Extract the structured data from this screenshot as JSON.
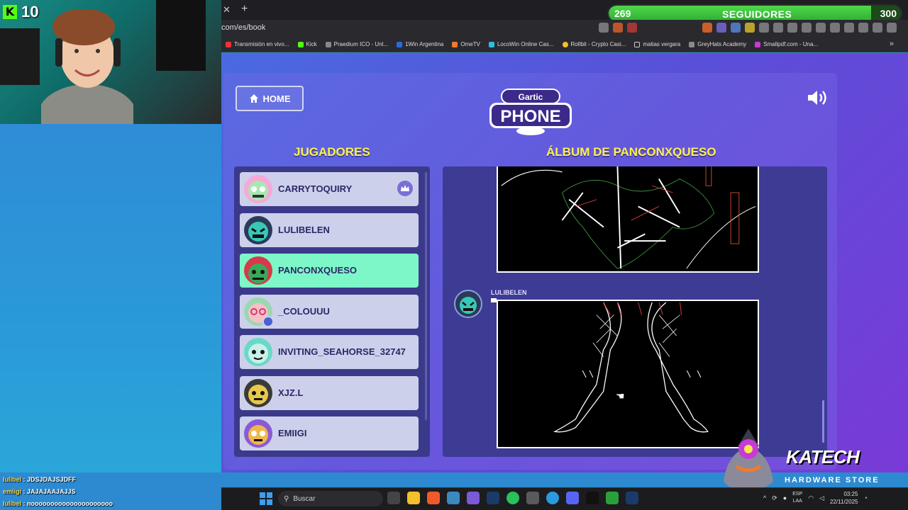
{
  "stream": {
    "kick_viewers": "10",
    "followers": {
      "current": "269",
      "label": "SEGUIDORES",
      "goal": "300",
      "progress": 0.897
    }
  },
  "browser": {
    "url": "com/es/book",
    "bookmarks": [
      "Transmisión en vivo...",
      "Kick",
      "Praedium ICO - Unl...",
      "1Win Argentina",
      "OmeTV",
      "LocoWin Online Cas...",
      "Rollbit - Crypto Casi...",
      "matias vergara",
      "GreyHats Academy",
      "Smallpdf.com - Una..."
    ]
  },
  "game": {
    "home_label": "HOME",
    "logo_line1": "Gartic",
    "logo_line2": "PHONE",
    "players_heading": "JUGADORES",
    "album_heading": "ÁLBUM DE PANCONXQUESO",
    "players": [
      {
        "name": "CARRYTOQUIRY",
        "host": true
      },
      {
        "name": "LULIBELEN"
      },
      {
        "name": "PANCONXQUESO",
        "active": true
      },
      {
        "name": "_COLOUUU"
      },
      {
        "name": "INVITING_SEAHORSE_32747"
      },
      {
        "name": "XJZ.L"
      },
      {
        "name": "EMIIGI"
      }
    ],
    "album_entry_author": "LULIBELEN"
  },
  "sponsor": {
    "name": "KATECH",
    "tagline": "HARDWARE STORE"
  },
  "chat": [
    {
      "user": "lulibel",
      "text": "JDSJDAJSJDFF"
    },
    {
      "user": "emiigi",
      "text": "JAJAJAAJAJJS"
    },
    {
      "user": "lulibel",
      "text": "nooooooooooooooooooooo"
    }
  ],
  "taskbar": {
    "search_placeholder": "Buscar",
    "lang_top": "ESP",
    "lang_bottom": "LAA",
    "time": "03:25",
    "date": "22/11/2025"
  },
  "colors": {
    "accent_yellow": "#fff04d",
    "active_player": "#7df7c7",
    "kick_green": "#53fc18"
  }
}
